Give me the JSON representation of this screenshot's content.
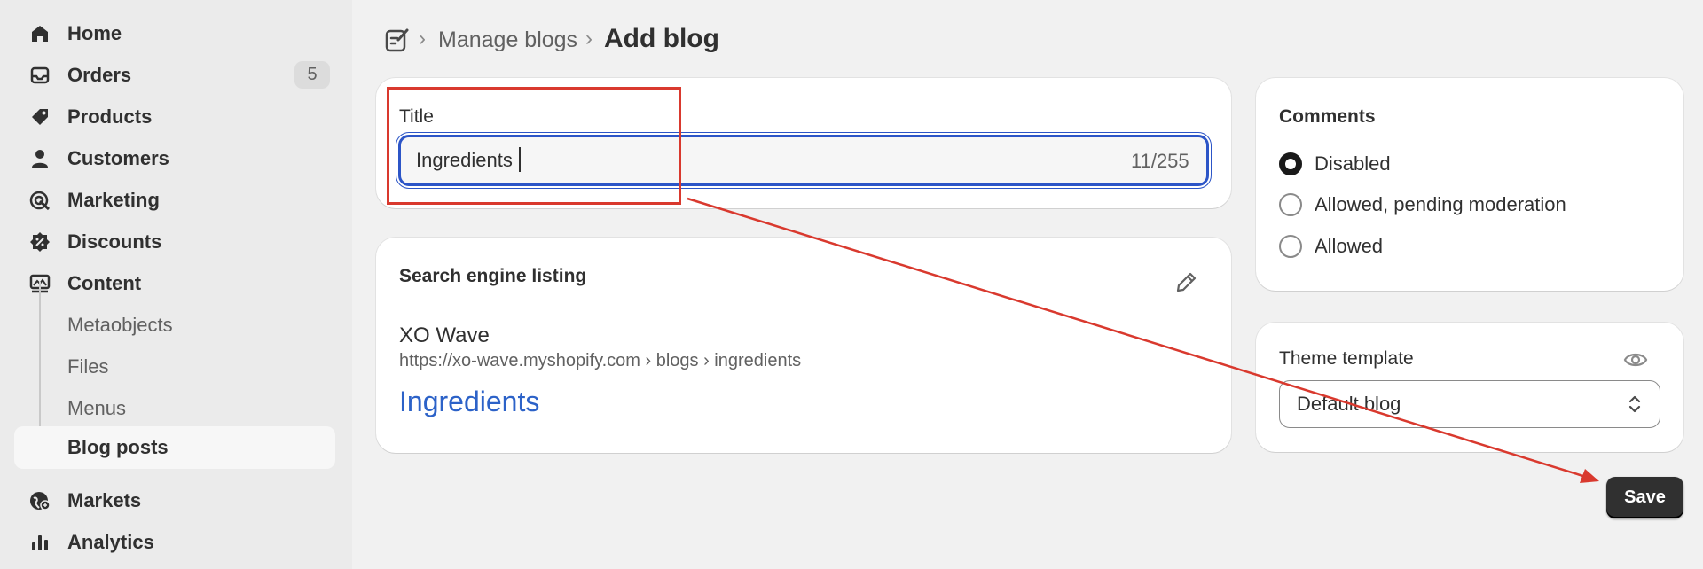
{
  "sidebar": {
    "items": [
      {
        "label": "Home",
        "icon": "home-icon"
      },
      {
        "label": "Orders",
        "icon": "inbox-icon",
        "badge": "5"
      },
      {
        "label": "Products",
        "icon": "tag-icon"
      },
      {
        "label": "Customers",
        "icon": "person-icon"
      },
      {
        "label": "Marketing",
        "icon": "target-icon"
      },
      {
        "label": "Discounts",
        "icon": "discount-icon"
      },
      {
        "label": "Content",
        "icon": "content-icon"
      }
    ],
    "sub_items": [
      {
        "label": "Metaobjects"
      },
      {
        "label": "Files"
      },
      {
        "label": "Menus"
      },
      {
        "label": "Blog posts",
        "active": true
      }
    ],
    "bottom_items": [
      {
        "label": "Markets",
        "icon": "globe-icon"
      },
      {
        "label": "Analytics",
        "icon": "bar-chart-icon"
      }
    ]
  },
  "breadcrumb": {
    "icon": "blog-edit-icon",
    "separator": "›",
    "parent": "Manage blogs",
    "current": "Add blog"
  },
  "title_card": {
    "label": "Title",
    "value": "Ingredients",
    "counter": "11/255"
  },
  "seo_card": {
    "heading": "Search engine listing",
    "edit_icon": "pencil-icon",
    "store_name": "XO Wave",
    "url": "https://xo-wave.myshopify.com › blogs › ingredients",
    "page_title": "Ingredients"
  },
  "comments_card": {
    "heading": "Comments",
    "options": [
      {
        "label": "Disabled",
        "checked": true
      },
      {
        "label": "Allowed, pending moderation",
        "checked": false
      },
      {
        "label": "Allowed",
        "checked": false
      }
    ]
  },
  "theme_card": {
    "label": "Theme template",
    "preview_icon": "eye-icon",
    "selected": "Default blog"
  },
  "actions": {
    "save_label": "Save"
  },
  "colors": {
    "focus_ring": "#2c55c7",
    "link": "#2c62c8",
    "annotation": "#d9392e",
    "primary_button": "#303030"
  }
}
